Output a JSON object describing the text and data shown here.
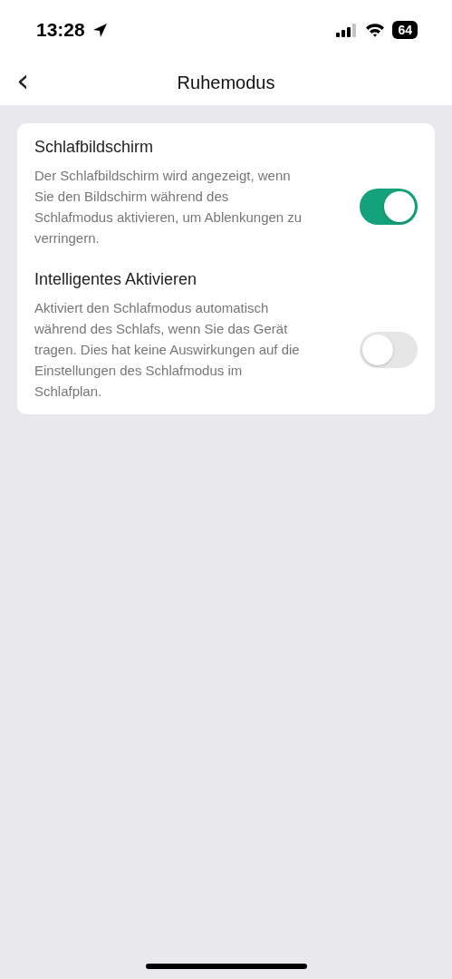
{
  "status_bar": {
    "time": "13:28",
    "battery": "64"
  },
  "header": {
    "back": "‹",
    "title": "Ruhemodus"
  },
  "settings": [
    {
      "title": "Schlafbildschirm",
      "description": "Der Schlafbildschirm wird angezeigt, wenn Sie den Bildschirm während des Schlafmodus aktivieren, um Ablenkungen zu verringern.",
      "on": true
    },
    {
      "title": "Intelligentes Aktivieren",
      "description": "Aktiviert den Schlafmodus automatisch während des Schlafs, wenn Sie das Gerät tragen. Dies hat keine Auswirkungen auf die Einstellungen des Schlafmodus im Schlafplan.",
      "on": false
    }
  ]
}
